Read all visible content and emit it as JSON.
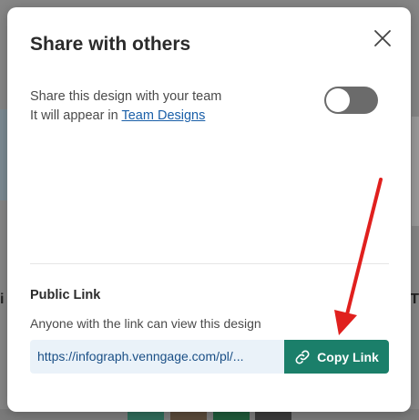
{
  "background": {
    "left_text": "i",
    "right_text": "T"
  },
  "dialog": {
    "title": "Share with others",
    "close_icon": "close-icon",
    "team_share": {
      "line1": "Share this design with your team",
      "line2_prefix": "It will appear in ",
      "link_text": "Team Designs",
      "toggle_on": false
    },
    "public_link": {
      "title": "Public Link",
      "description": "Anyone with the link can view this design",
      "url": "https://infograph.venngage.com/pl/...",
      "copy_label": "Copy Link",
      "copy_icon": "link-icon"
    }
  },
  "colors": {
    "accent": "#1b7f6a",
    "link": "#1a5fa8",
    "field_bg": "#eaf2f9",
    "toggle_off": "#6b6b6b",
    "annotation_arrow": "#e0201e"
  }
}
